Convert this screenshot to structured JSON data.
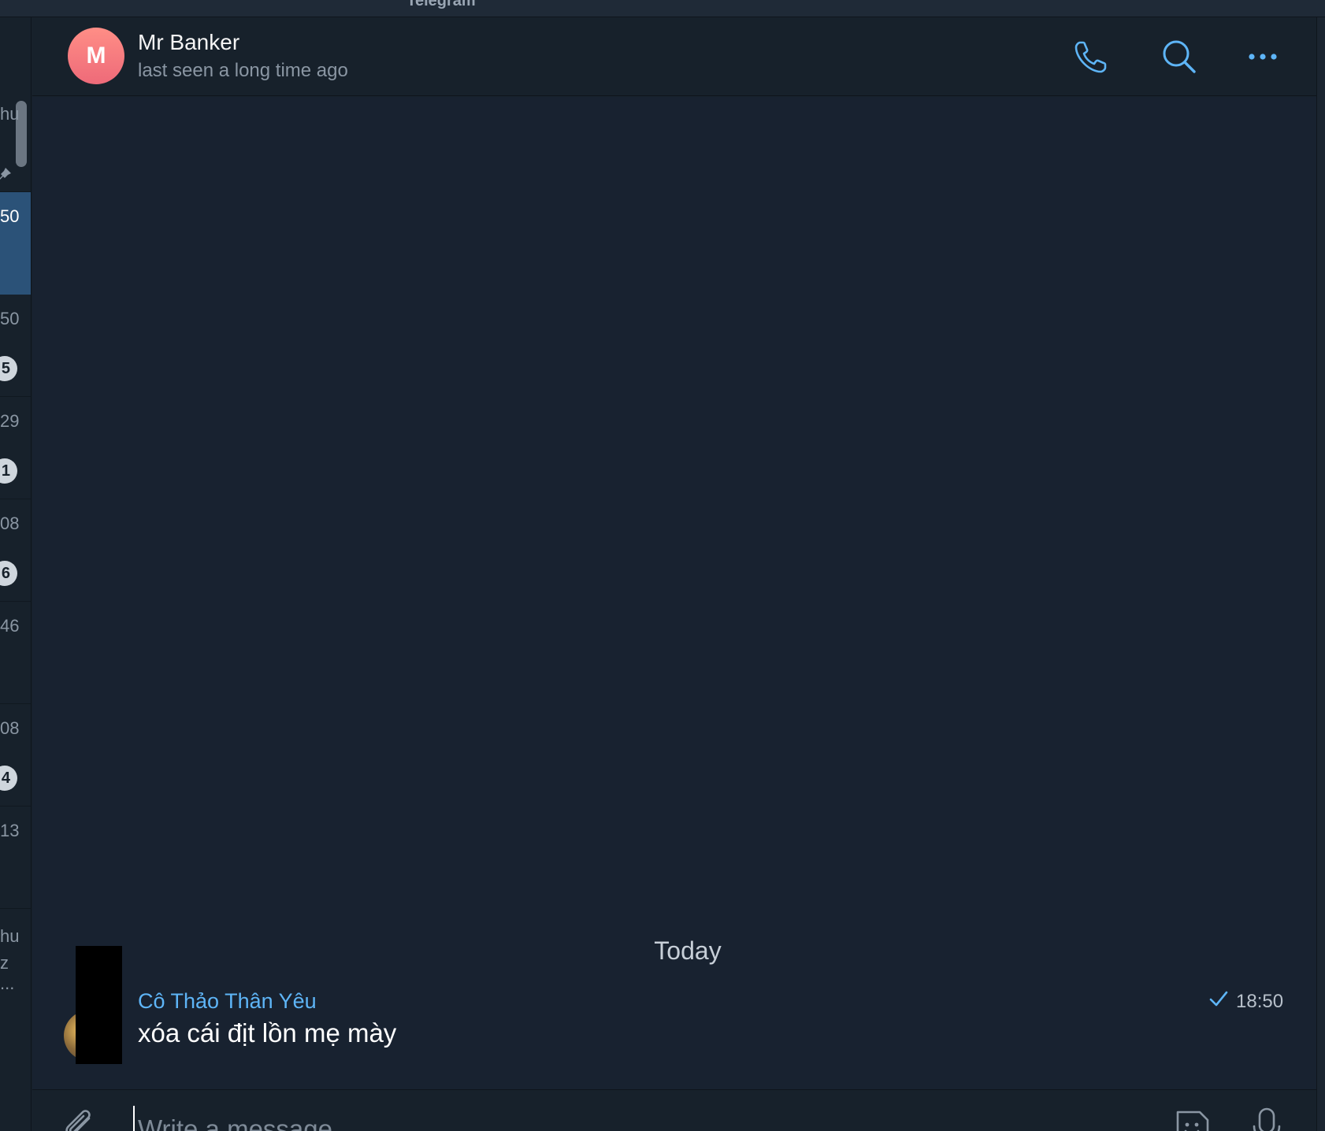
{
  "window": {
    "title": "Telegram"
  },
  "chat_list": {
    "rows": [
      {
        "text": "hu",
        "badge": ""
      },
      {
        "time": "50",
        "badge": "",
        "selected": true
      },
      {
        "time": "50",
        "badge": "5"
      },
      {
        "time": "29",
        "badge": "1"
      },
      {
        "time": "08",
        "badge": "6"
      },
      {
        "time": "46",
        "badge": ""
      },
      {
        "time": "08",
        "badge": "4"
      },
      {
        "time": "13",
        "badge": ""
      },
      {
        "text": "hu",
        "text2": "z",
        "text3": "..."
      }
    ],
    "icons": {
      "pin": "pin-icon"
    }
  },
  "header": {
    "avatar_letter": "M",
    "name": "Mr Banker",
    "status": "last seen a long time ago",
    "icons": {
      "call": "phone-icon",
      "search": "search-icon",
      "more": "more-dots-icon"
    },
    "accent_color": "#5eb5f7"
  },
  "messages": {
    "date_separator": "Today",
    "items": [
      {
        "sender": "Cô Thảo Thân Yêu",
        "text": "xóa cái địt lồn mẹ mày",
        "time": "18:50",
        "status_icon": "check-icon"
      }
    ]
  },
  "composer": {
    "placeholder": "Write a message...",
    "icons": {
      "attach": "paperclip-icon",
      "emoji": "sticker-icon",
      "voice": "microphone-icon"
    }
  },
  "colors": {
    "background": "#17212b",
    "selected_row": "#2b5278",
    "sender_name": "#5eb5f7",
    "avatar_gradient_top": "#ff8e86",
    "avatar_gradient_bottom": "#ee6a79"
  }
}
